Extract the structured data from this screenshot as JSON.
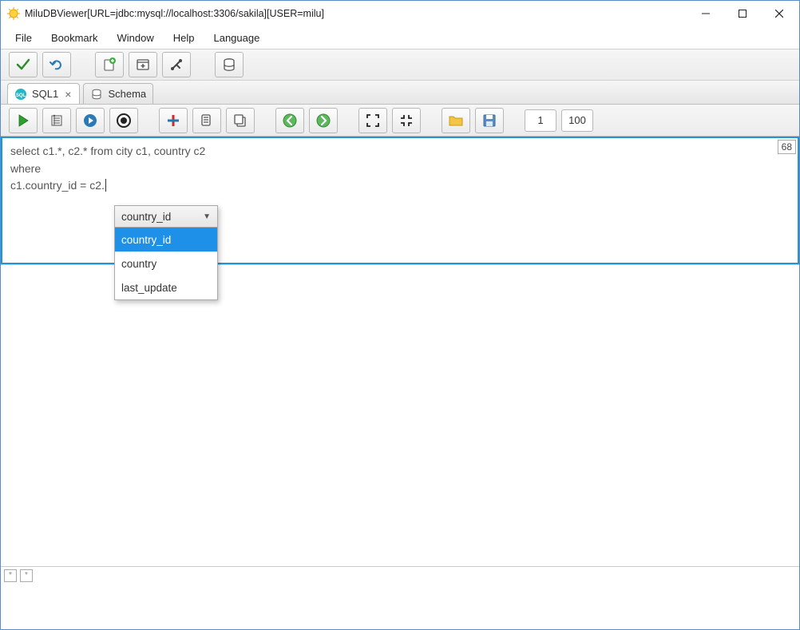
{
  "window": {
    "title": "MiluDBViewer[URL=jdbc:mysql://localhost:3306/sakila][USER=milu]"
  },
  "menu": {
    "items": [
      "File",
      "Bookmark",
      "Window",
      "Help",
      "Language"
    ]
  },
  "tabs": {
    "active": {
      "label": "SQL1"
    },
    "inactive": {
      "label": "Schema"
    }
  },
  "toolbar2": {
    "page_from": "1",
    "page_to": "100"
  },
  "editor": {
    "sql_line1": "select c1.*, c2.* from city c1, country c2",
    "sql_line2": "where",
    "sql_line3": "c1.country_id = c2.",
    "char_count": "68"
  },
  "autocomplete": {
    "selected": "country_id",
    "options": [
      "country_id",
      "country",
      "last_update"
    ]
  },
  "status": {
    "box1": "*",
    "box2": "*"
  }
}
